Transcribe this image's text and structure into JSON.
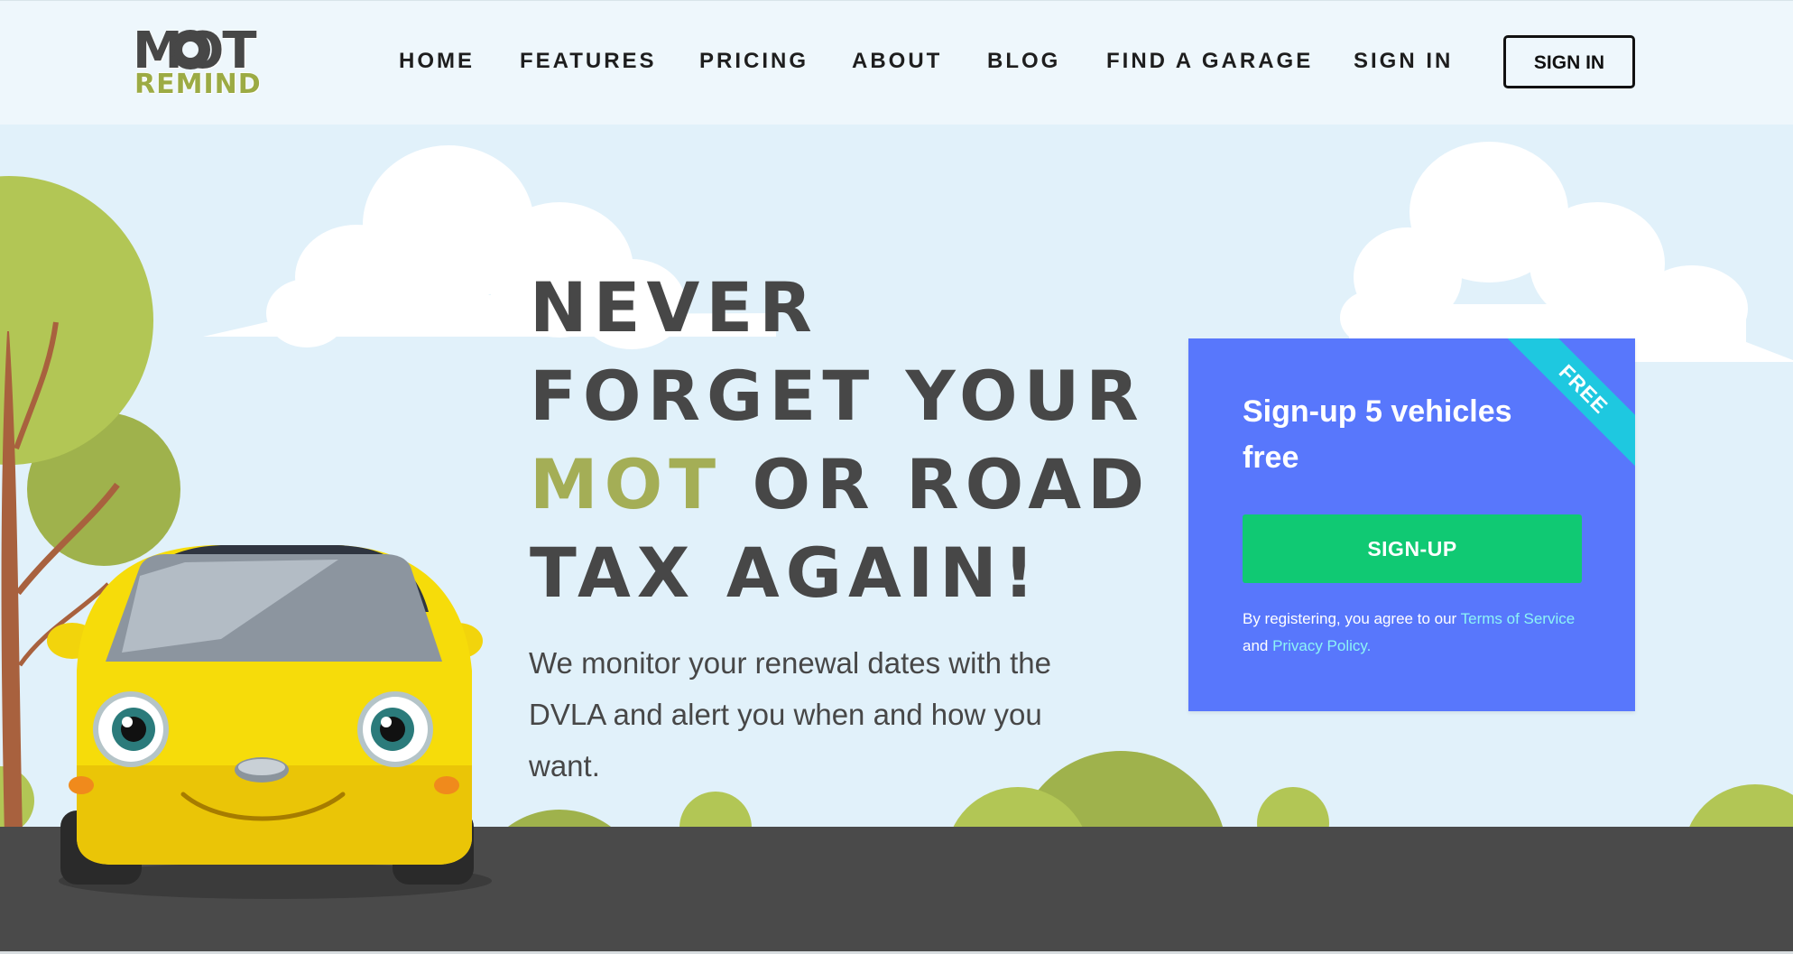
{
  "brand": {
    "logo_top": "MOT",
    "logo_bottom": "REMIND"
  },
  "nav": {
    "items": [
      {
        "label": "HOME"
      },
      {
        "label": "FEATURES"
      },
      {
        "label": "PRICING"
      },
      {
        "label": "ABOUT"
      },
      {
        "label": "BLOG"
      },
      {
        "label": "FIND A GARAGE"
      },
      {
        "label": "SIGN IN"
      }
    ],
    "signin_button": "SIGN IN"
  },
  "hero": {
    "line1": "NEVER",
    "line2": "FORGET YOUR",
    "line3_accent": "MOT",
    "line3_rest": " OR ROAD",
    "line4": "TAX AGAIN!",
    "subtitle": "We monitor your renewal dates with the DVLA and alert you when and how you want."
  },
  "signup_card": {
    "ribbon": "FREE",
    "title": "Sign-up 5 vehicles free",
    "button": "SIGN-UP",
    "note_prefix": "By registering, you agree to our ",
    "terms_link": "Terms of Service",
    "note_middle": " and ",
    "privacy_link": "Privacy Policy."
  },
  "colors": {
    "sky": "#e1f1fa",
    "header": "#eef7fc",
    "text_dark": "#474747",
    "accent_olive": "#a4ae56",
    "card_blue": "#5877fc",
    "ribbon_cyan": "#1ec8e0",
    "button_green": "#10c973",
    "road": "#4a4a4a",
    "car_yellow": "#f6dc0a"
  }
}
